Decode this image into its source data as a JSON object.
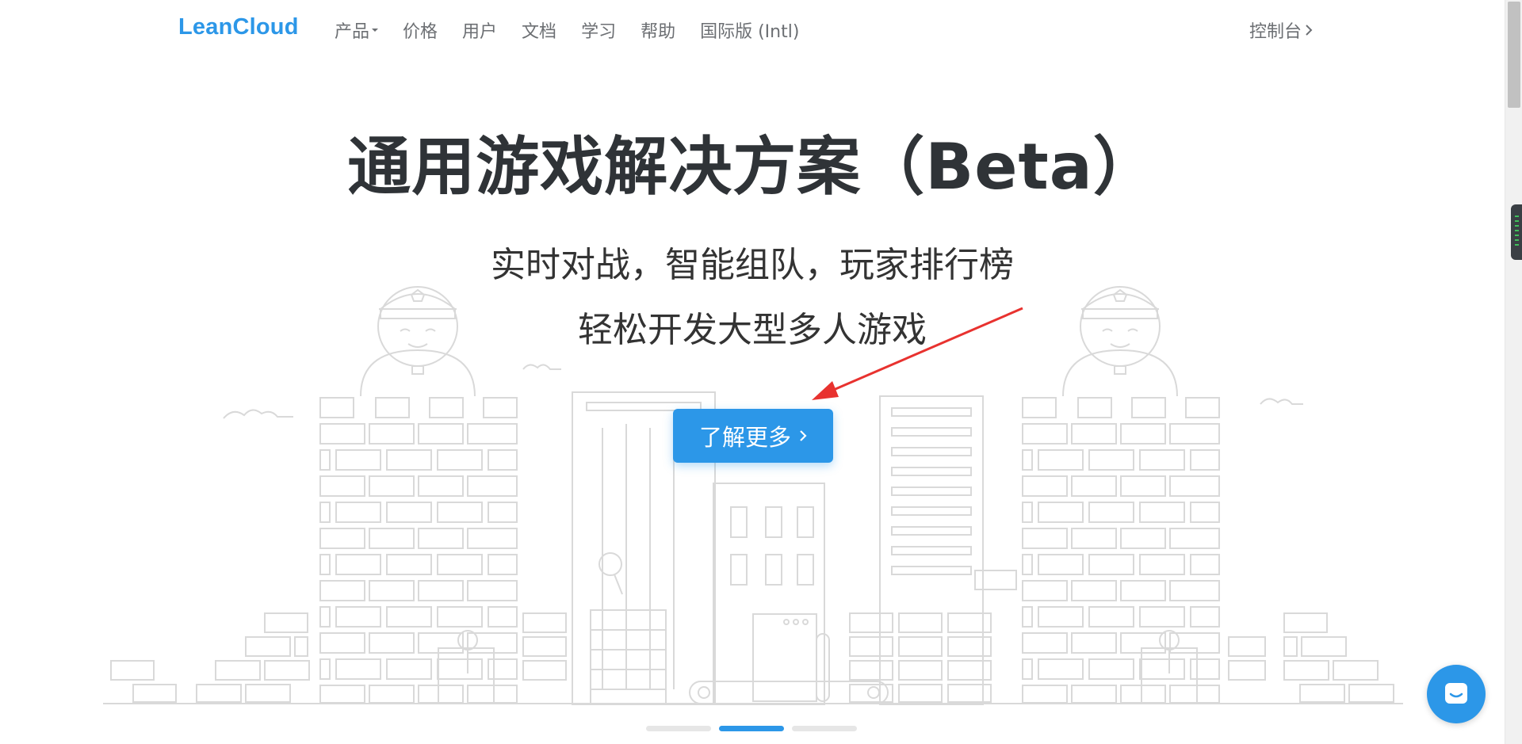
{
  "brand": "LeanCloud",
  "nav": {
    "items": [
      {
        "label": "产品",
        "has_dropdown": true
      },
      {
        "label": "价格"
      },
      {
        "label": "用户"
      },
      {
        "label": "文档"
      },
      {
        "label": "学习"
      },
      {
        "label": "帮助"
      },
      {
        "label": "国际版 (Intl)"
      }
    ],
    "console_label": "控制台"
  },
  "hero": {
    "title": "通用游戏解决方案（Beta）",
    "subtitle_1": "实时对战，智能组队，玩家排行榜",
    "subtitle_2": "轻松开发大型多人游戏",
    "cta_label": "了解更多"
  },
  "carousel": {
    "slides": 3,
    "active_index": 1
  },
  "colors": {
    "accent": "#2c97e8",
    "arrow": "#e8322f",
    "illustration": "#d9d9d9"
  },
  "icons": [
    "chevron-right-icon",
    "chat-icon",
    "red-arrow-annotation"
  ]
}
